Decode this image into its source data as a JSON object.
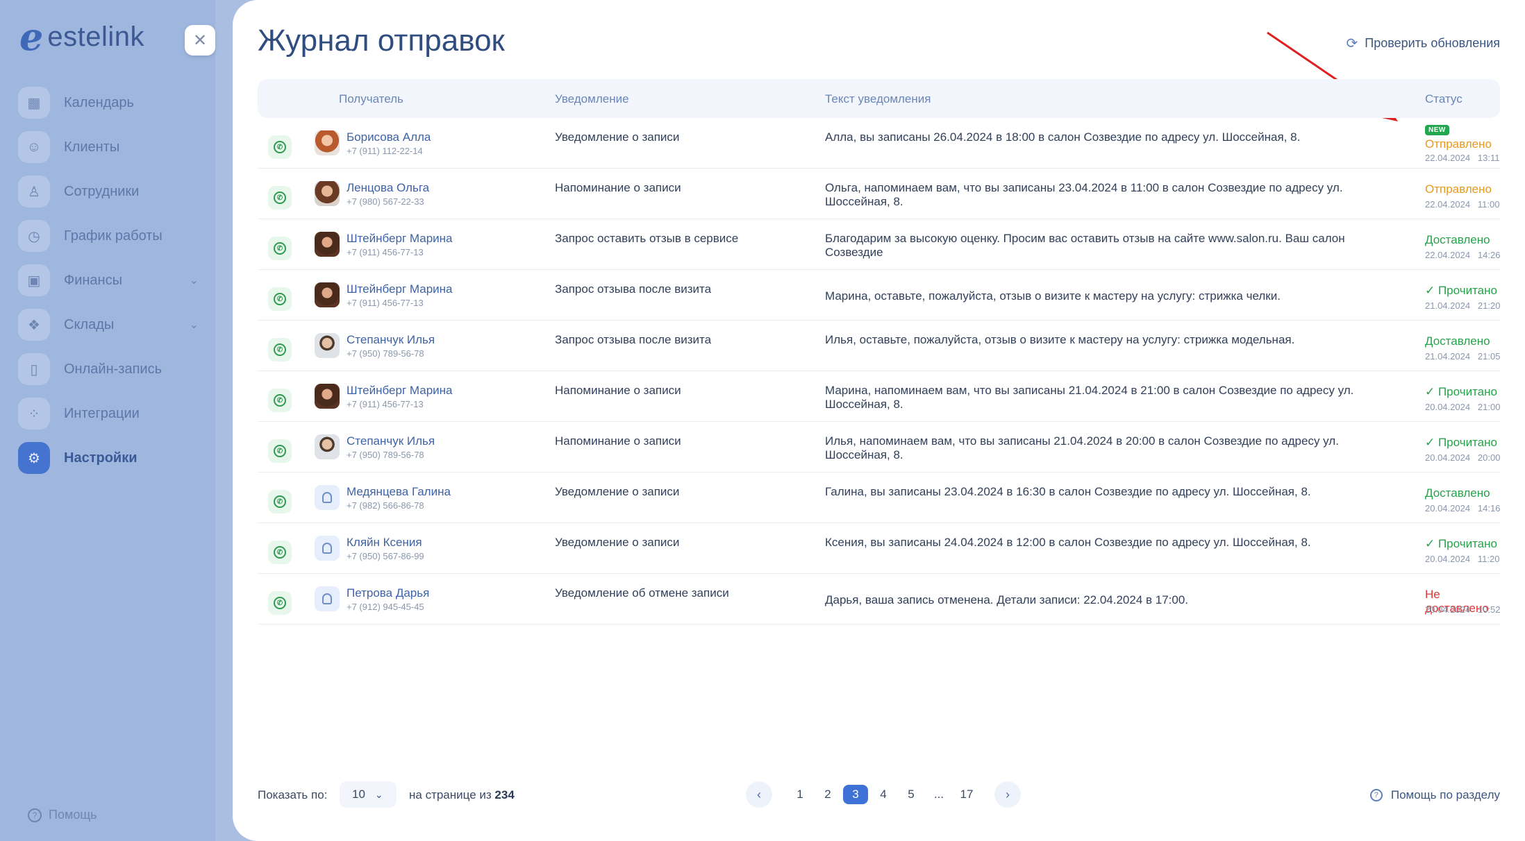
{
  "brand": {
    "logo_mark": "e",
    "name": "estelink"
  },
  "sidebar": {
    "items": [
      {
        "label": "Календарь",
        "icon": "calendar-icon"
      },
      {
        "label": "Клиенты",
        "icon": "users-icon"
      },
      {
        "label": "Сотрудники",
        "icon": "user-icon"
      },
      {
        "label": "График работы",
        "icon": "clock-icon"
      },
      {
        "label": "Финансы",
        "icon": "wallet-icon"
      },
      {
        "label": "Склады",
        "icon": "boxes-icon"
      },
      {
        "label": "Онлайн-запись",
        "icon": "phone-icon"
      },
      {
        "label": "Интеграции",
        "icon": "grid-icon"
      },
      {
        "label": "Настройки",
        "icon": "gear-icon"
      }
    ],
    "help": "Помощь"
  },
  "header": {
    "title": "Журнал отправок",
    "check_updates": "Проверить обновления"
  },
  "table": {
    "columns": {
      "recipient": "Получатель",
      "notification": "Уведомление",
      "text": "Текст уведомления",
      "status": "Статус"
    },
    "badge_new": "NEW",
    "rows": [
      {
        "name": "Борисова Алла",
        "phone": "+7 (911) 112-22-14",
        "type": "Уведомление о записи",
        "text": "Алла, вы записаны 26.04.2024 в 18:00 в салон Созвездие по адресу ул. Шоссейная, 8.",
        "status": "Отправлено",
        "status_kind": "sent",
        "date": "22.04.2024",
        "time": "13:11"
      },
      {
        "name": "Ленцова Ольга",
        "phone": "+7 (980) 567-22-33",
        "type": "Напоминание о записи",
        "text": "Ольга, напоминаем вам, что вы записаны 23.04.2024 в 11:00 в салон Созвездие по адресу ул. Шоссейная, 8.",
        "status": "Отправлено",
        "status_kind": "sent",
        "date": "22.04.2024",
        "time": "11:00"
      },
      {
        "name": "Штейнберг Марина",
        "phone": "+7 (911) 456-77-13",
        "type": "Запрос оставить отзыв в сервисе",
        "text": "Благодарим за высокую оценку. Просим вас оставить отзыв на сайте www.salon.ru. Ваш салон Созвездие",
        "status": "Доставлено",
        "status_kind": "delivered",
        "date": "22.04.2024",
        "time": "14:26"
      },
      {
        "name": "Штейнберг Марина",
        "phone": "+7 (911) 456-77-13",
        "type": "Запрос отзыва после визита",
        "text": "Марина, оставьте, пожалуйста, отзыв о визите к мастеру на услугу: стрижка челки.",
        "status": "✓ Прочитано",
        "status_kind": "read",
        "date": "21.04.2024",
        "time": "21:20"
      },
      {
        "name": "Степанчук Илья",
        "phone": "+7 (950) 789-56-78",
        "type": "Запрос отзыва после визита",
        "text": "Илья, оставьте, пожалуйста, отзыв о визите к мастеру на услугу: стрижка модельная.",
        "status": "Доставлено",
        "status_kind": "delivered",
        "date": "21.04.2024",
        "time": "21:05"
      },
      {
        "name": "Штейнберг Марина",
        "phone": "+7 (911) 456-77-13",
        "type": "Напоминание о записи",
        "text": "Марина, напоминаем вам, что вы записаны 21.04.2024 в 21:00 в салон Созвездие по адресу ул. Шоссейная, 8.",
        "status": "✓ Прочитано",
        "status_kind": "read",
        "date": "20.04.2024",
        "time": "21:00"
      },
      {
        "name": "Степанчук Илья",
        "phone": "+7 (950) 789-56-78",
        "type": "Напоминание о записи",
        "text": "Илья, напоминаем вам, что вы записаны 21.04.2024 в 20:00 в салон Созвездие по адресу ул. Шоссейная, 8.",
        "status": "✓ Прочитано",
        "status_kind": "read",
        "date": "20.04.2024",
        "time": "20:00"
      },
      {
        "name": "Медянцева Галина",
        "phone": "+7 (982) 566-86-78",
        "type": "Уведомление о записи",
        "text": "Галина, вы записаны 23.04.2024 в 16:30 в салон Созвездие по адресу ул. Шоссейная, 8.",
        "status": "Доставлено",
        "status_kind": "delivered",
        "date": "20.04.2024",
        "time": "14:16"
      },
      {
        "name": "Кляйн Ксения",
        "phone": "+7 (950) 567-86-99",
        "type": "Уведомление о записи",
        "text": "Ксения, вы записаны 24.04.2024 в 12:00 в салон Созвездие по адресу ул. Шоссейная, 8.",
        "status": "✓ Прочитано",
        "status_kind": "read",
        "date": "20.04.2024",
        "time": "11:20"
      },
      {
        "name": "Петрова Дарья",
        "phone": "+7 (912) 945-45-45",
        "type": "Уведомление об отмене записи",
        "text": "Дарья, ваша запись отменена. Детали записи: 22.04.2024 в 17:00.",
        "status": "Не доставлено",
        "status_kind": "failed",
        "date": "20.04.2024",
        "time": "10:52"
      }
    ]
  },
  "footer": {
    "show_label": "Показать по:",
    "per_page": "10",
    "of_label": "на странице из",
    "total": "234",
    "pages": [
      "1",
      "2",
      "3",
      "4",
      "5",
      "...",
      "17"
    ],
    "current_page": "3",
    "help": "Помощь по разделу"
  },
  "colors": {
    "accent": "#3f72d6",
    "sent": "#e69a1e",
    "delivered": "#27a24b",
    "failed": "#e23535",
    "annotation_arrow": "#e02020"
  }
}
